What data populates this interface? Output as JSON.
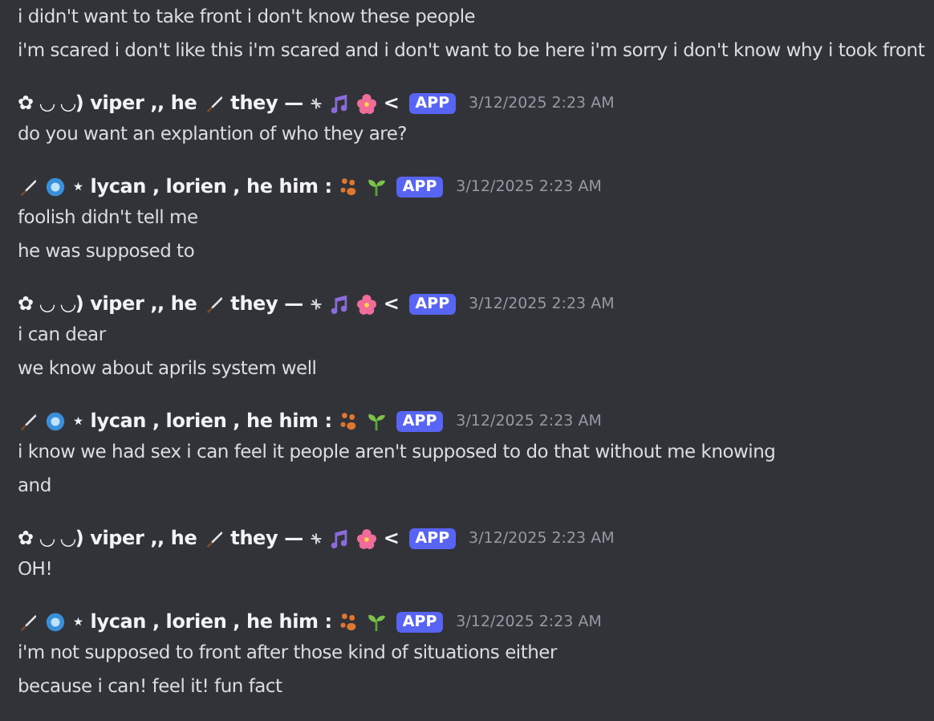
{
  "messages": [
    {
      "lines": [
        "i didn't want to take front i don't know these people",
        "i'm scared i don't like this i'm scared and i don't want to be here i'm sorry i don't know why i took front"
      ]
    },
    {
      "author": [
        {
          "kind": "text",
          "text": "✿ ◡ ◡) viper ,, he"
        },
        {
          "kind": "blade"
        },
        {
          "kind": "text",
          "text": "they —"
        },
        {
          "kind": "sparkle"
        },
        {
          "kind": "music"
        },
        {
          "kind": "flower"
        },
        {
          "kind": "text",
          "text": "<"
        }
      ],
      "badge": "APP",
      "timestamp": "3/12/2025 2:23 AM",
      "lines": [
        "do you want an explantion of who they are?"
      ]
    },
    {
      "author": [
        {
          "kind": "blade"
        },
        {
          "kind": "orb"
        },
        {
          "kind": "text",
          "text": "⋆ lycan , lorien , he him :"
        },
        {
          "kind": "paw"
        },
        {
          "kind": "sprout"
        }
      ],
      "badge": "APP",
      "timestamp": "3/12/2025 2:23 AM",
      "lines": [
        "foolish didn't tell me",
        "he was supposed to"
      ]
    },
    {
      "author": [
        {
          "kind": "text",
          "text": "✿ ◡ ◡) viper ,, he"
        },
        {
          "kind": "blade"
        },
        {
          "kind": "text",
          "text": "they —"
        },
        {
          "kind": "sparkle"
        },
        {
          "kind": "music"
        },
        {
          "kind": "flower"
        },
        {
          "kind": "text",
          "text": "<"
        }
      ],
      "badge": "APP",
      "timestamp": "3/12/2025 2:23 AM",
      "lines": [
        "i can dear",
        "we know about aprils system well"
      ]
    },
    {
      "author": [
        {
          "kind": "blade"
        },
        {
          "kind": "orb"
        },
        {
          "kind": "text",
          "text": "⋆ lycan , lorien , he him :"
        },
        {
          "kind": "paw"
        },
        {
          "kind": "sprout"
        }
      ],
      "badge": "APP",
      "timestamp": "3/12/2025 2:23 AM",
      "lines": [
        "i know we had sex i can feel it people aren't supposed to do that without me knowing",
        "and"
      ]
    },
    {
      "author": [
        {
          "kind": "text",
          "text": "✿ ◡ ◡) viper ,, he"
        },
        {
          "kind": "blade"
        },
        {
          "kind": "text",
          "text": "they —"
        },
        {
          "kind": "sparkle"
        },
        {
          "kind": "music"
        },
        {
          "kind": "flower"
        },
        {
          "kind": "text",
          "text": "<"
        }
      ],
      "badge": "APP",
      "timestamp": "3/12/2025 2:23 AM",
      "lines": [
        "OH!"
      ]
    },
    {
      "author": [
        {
          "kind": "blade"
        },
        {
          "kind": "orb"
        },
        {
          "kind": "text",
          "text": "⋆ lycan , lorien , he him :"
        },
        {
          "kind": "paw"
        },
        {
          "kind": "sprout"
        }
      ],
      "badge": "APP",
      "timestamp": "3/12/2025 2:23 AM",
      "lines": [
        "i'm not supposed to front after those kind of situations either",
        "because i can! feel it! fun fact"
      ]
    }
  ]
}
